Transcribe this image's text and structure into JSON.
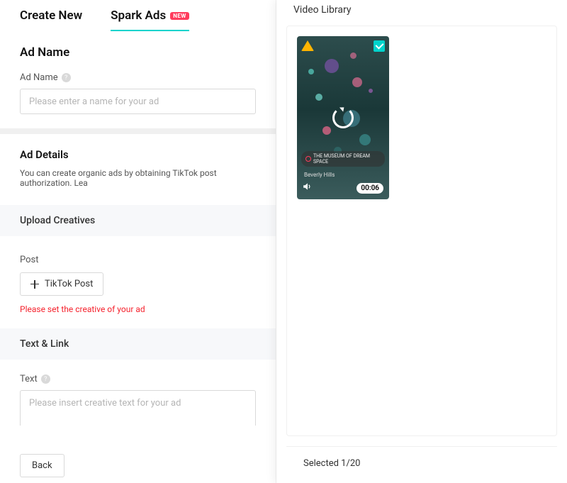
{
  "tabs": {
    "create": "Create New",
    "spark": "Spark Ads",
    "badge": "NEW"
  },
  "adName": {
    "sectionTitle": "Ad Name",
    "fieldLabel": "Ad Name",
    "placeholder": "Please enter a name for your ad"
  },
  "adDetails": {
    "title": "Ad Details",
    "description": "You can create organic ads by obtaining TikTok post authorization. Lea"
  },
  "upload": {
    "header": "Upload Creatives",
    "postLabel": "Post",
    "buttonLabel": "TikTok Post",
    "error": "Please set the creative of your ad"
  },
  "textLink": {
    "header": "Text & Link",
    "fieldLabel": "Text",
    "placeholder": "Please insert creative text for your ad"
  },
  "buttons": {
    "back": "Back"
  },
  "library": {
    "title": "Video Library",
    "footer": "Selected 1/20",
    "thumb": {
      "tag": "THE MUSEUM OF DREAM SPACE",
      "location": "Beverly Hills",
      "duration": "00:06"
    }
  }
}
